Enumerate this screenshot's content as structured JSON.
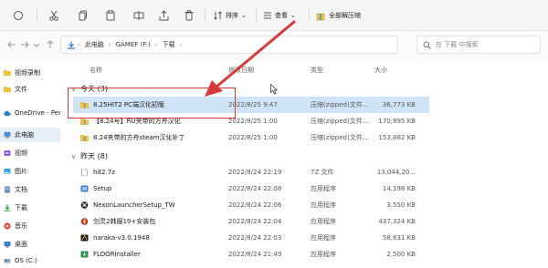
{
  "toolbar": {
    "sort_label": "排序",
    "view_label": "查看",
    "extract_all_label": "全部解压缩"
  },
  "address": {
    "crumbs": [
      "此电脑",
      "GAMEF (F:)",
      "下载"
    ]
  },
  "search": {
    "placeholder": "在 下载 中搜索"
  },
  "sidebar": {
    "items": [
      {
        "label": "视频录制"
      },
      {
        "label": "文件"
      },
      {
        "label": "OneDrive - Pers"
      },
      {
        "label": "此电脑"
      },
      {
        "label": "视频"
      },
      {
        "label": "图片"
      },
      {
        "label": "文档"
      },
      {
        "label": "下载"
      },
      {
        "label": "音乐"
      },
      {
        "label": "桌面"
      },
      {
        "label": "OS (C:)"
      }
    ]
  },
  "columns": {
    "name": "名称",
    "date": "修改日期",
    "type": "类型",
    "size": "大小"
  },
  "groups": [
    {
      "label": "今天 (3)",
      "files": [
        {
          "name": "8.25HIT2 PC端汉化初版",
          "date": "2022/8/25 9:47",
          "type": "压缩(zipped)文件...",
          "size": "36,773 KB",
          "icon": "zip-folder-icon"
        },
        {
          "name": "【8.24号】RU夹带的方舟汉化",
          "date": "2022/8/25 1:00",
          "type": "压缩(zipped)文件...",
          "size": "170,895 KB",
          "icon": "zip-folder-icon"
        },
        {
          "name": "8.24夹带的方舟steam汉化补丁",
          "date": "2022/8/25 1:00",
          "type": "压缩(zipped)文件...",
          "size": "153,882 KB",
          "icon": "zip-folder-icon"
        }
      ]
    },
    {
      "label": "昨天 (8)",
      "files": [
        {
          "name": "hit2.7z",
          "date": "2022/8/24 22:19",
          "type": "7Z 文件",
          "size": "13,044,20...",
          "icon": "file-icon"
        },
        {
          "name": "Setup",
          "date": "2022/8/24 22:08",
          "type": "应用程序",
          "size": "14,198 KB",
          "icon": "setup-icon"
        },
        {
          "name": "NexonLauncherSetup_TW",
          "date": "2022/8/24 22:06",
          "type": "应用程序",
          "size": "3,550 KB",
          "icon": "nexon-icon"
        },
        {
          "name": "剑灵2韩服19+安装包",
          "date": "2022/8/24 22:04",
          "type": "应用程序",
          "size": "437,324 KB",
          "icon": "game-icon"
        },
        {
          "name": "naraka-v3.0.1948",
          "date": "2022/8/24 22:03",
          "type": "应用程序",
          "size": "58,631 KB",
          "icon": "naraka-icon"
        },
        {
          "name": "FLOORInstaller",
          "date": "2022/8/24 21:49",
          "type": "应用程序",
          "size": "2,500 KB",
          "icon": "installer-icon"
        }
      ]
    }
  ],
  "colors": {
    "selection": "#cfe4f7",
    "highlight_border": "#d63a3a",
    "folder_yellow": "#f0c244",
    "accent_blue": "#2b7bd6"
  }
}
